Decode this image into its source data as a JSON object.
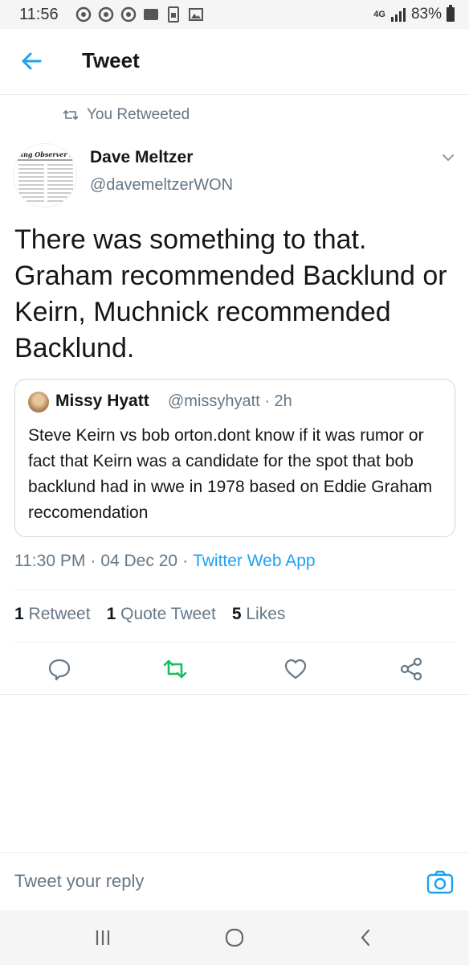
{
  "status_bar": {
    "time": "11:56",
    "network": "4G",
    "battery": "83%"
  },
  "header": {
    "title": "Tweet"
  },
  "retweet_notice": "You Retweeted",
  "author": {
    "name": "Dave Meltzer",
    "handle": "@davemeltzerWON",
    "avatar_text": "ling Observer News"
  },
  "tweet": {
    "text": "There was something to that. Graham recommended Backlund or Keirn, Muchnick recommended Backlund."
  },
  "quote": {
    "name": "Missy Hyatt",
    "handle": "@missyhyatt · 2h",
    "text": "Steve Keirn vs bob orton.dont know if it was rumor or fact that Keirn was a candidate for the spot that bob backlund had in wwe in 1978 based on Eddie Graham reccomendation"
  },
  "meta": {
    "time": "11:30 PM",
    "sep1": "·",
    "date": "04 Dec 20",
    "sep2": "·",
    "app": "Twitter Web App"
  },
  "stats": {
    "retweets_count": "1",
    "retweets_label": "Retweet",
    "quotes_count": "1",
    "quotes_label": "Quote Tweet",
    "likes_count": "5",
    "likes_label": "Likes"
  },
  "actions": [
    "reply-icon",
    "retweet-icon",
    "like-icon",
    "share-icon"
  ],
  "colors": {
    "accent": "#1da1f2",
    "retweet_active": "#17bf63",
    "muted": "#657786"
  },
  "reply": {
    "placeholder": "Tweet your reply"
  }
}
